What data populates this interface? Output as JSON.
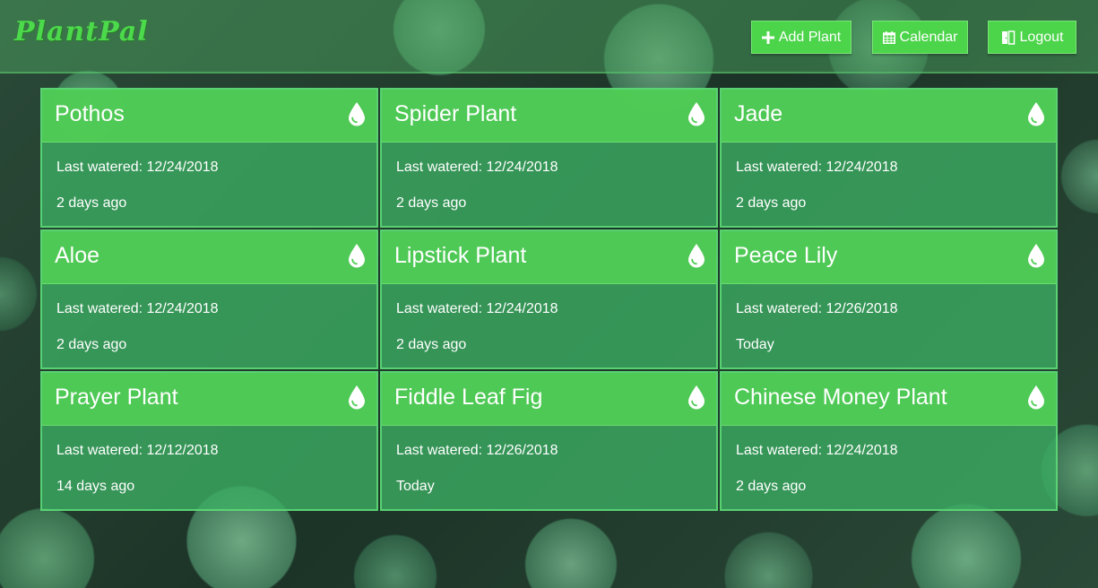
{
  "app": {
    "logo": "PlantPal"
  },
  "header": {
    "add_plant_label": "Add Plant",
    "calendar_label": "Calendar",
    "logout_label": "Logout"
  },
  "plants": [
    {
      "name": "Pothos",
      "last_watered": "Last watered: 12/24/2018",
      "ago": "2 days ago"
    },
    {
      "name": "Spider Plant",
      "last_watered": "Last watered: 12/24/2018",
      "ago": "2 days ago"
    },
    {
      "name": "Jade",
      "last_watered": "Last watered: 12/24/2018",
      "ago": "2 days ago"
    },
    {
      "name": "Aloe",
      "last_watered": "Last watered: 12/24/2018",
      "ago": "2 days ago"
    },
    {
      "name": "Lipstick Plant",
      "last_watered": "Last watered: 12/24/2018",
      "ago": "2 days ago"
    },
    {
      "name": "Peace Lily",
      "last_watered": "Last watered: 12/26/2018",
      "ago": "Today"
    },
    {
      "name": "Prayer Plant",
      "last_watered": "Last watered: 12/12/2018",
      "ago": "14 days ago"
    },
    {
      "name": "Fiddle Leaf Fig",
      "last_watered": "Last watered: 12/26/2018",
      "ago": "Today"
    },
    {
      "name": "Chinese Money Plant",
      "last_watered": "Last watered: 12/24/2018",
      "ago": "2 days ago"
    }
  ],
  "icons": {
    "add": "plus-icon",
    "calendar": "calendar-icon",
    "logout": "door-exit-icon",
    "water": "water-drop-icon"
  },
  "colors": {
    "accent": "#4cd44a",
    "logo": "#4cd94b",
    "card_header": "#50cd55",
    "card_body": "#3caf64"
  }
}
